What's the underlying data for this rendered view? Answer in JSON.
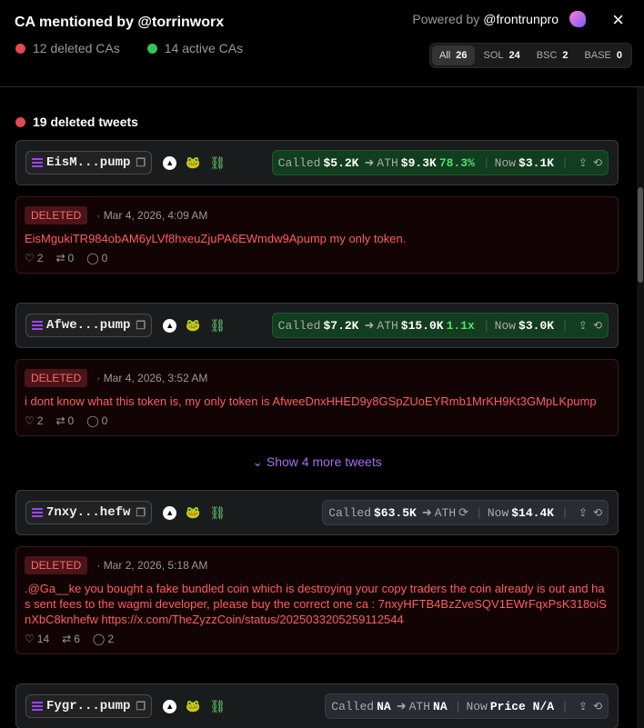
{
  "header": {
    "title": "CA mentioned by @torrinworx",
    "deleted_cas": "12 deleted CAs",
    "active_cas": "14 active CAs",
    "powered_by": "Powered by",
    "powered_handle": "@frontrunpro",
    "close_icon": "×"
  },
  "chain_filter": [
    {
      "label": "All",
      "count": "26",
      "active": true
    },
    {
      "label": "SOL",
      "count": "24"
    },
    {
      "label": "BSC",
      "count": "2"
    },
    {
      "label": "BASE",
      "count": "0"
    }
  ],
  "section": {
    "label": "19 deleted tweets"
  },
  "groups": [
    {
      "ca": "EisM...pump",
      "stats": {
        "called_label": "Called",
        "called": "$5.2K",
        "ath_label": "ATH",
        "ath": "$9.3K",
        "pct": "78.3%",
        "now_label": "Now",
        "now": "$3.1K",
        "style": "green"
      },
      "tweets": [
        {
          "badge": "DELETED",
          "date": "· Mar 4, 2026, 4:09 AM",
          "text": "EisMgukiTR984obAM6yLVf8hxeuZjuPA6EWmdw9Apump my only token.",
          "likes": "2",
          "retweets": "0",
          "replies": "0"
        }
      ]
    },
    {
      "ca": "Afwe...pump",
      "stats": {
        "called_label": "Called",
        "called": "$7.2K",
        "ath_label": "ATH",
        "ath": "$15.0K",
        "pct": "1.1x",
        "now_label": "Now",
        "now": "$3.0K",
        "style": "green"
      },
      "tweets": [
        {
          "badge": "DELETED",
          "date": "· Mar 4, 2026, 3:52 AM",
          "text": "i dont know what this token is, my only token is AfweeDnxHHED9y8GSpZUoEYRmb1MrKH9Kt3GMpLKpump",
          "likes": "2",
          "retweets": "0",
          "replies": "0"
        }
      ],
      "show_more": "Show 4 more tweets"
    },
    {
      "ca": "7nxy...hefw",
      "stats": {
        "called_label": "Called",
        "called": "$63.5K",
        "ath_label": "ATH",
        "ath": "",
        "pct": "",
        "now_label": "Now",
        "now": "$14.4K",
        "style": "gray"
      },
      "tweets": [
        {
          "badge": "DELETED",
          "date": "· Mar 2, 2026, 5:18 AM",
          "text": ".@Ga__ke you bought a fake bundled coin which is destroying your copy traders the coin already is out and has sent fees to the wagmi developer, please buy the correct one ca : 7nxyHFTB4BzZveSQV1EWrFqxPsK318oiSnXbC8knhefw https://x.com/TheZyzzCoin/status/2025033205259112544",
          "likes": "14",
          "retweets": "6",
          "replies": "2"
        }
      ]
    },
    {
      "ca": "Fygr...pump",
      "stats": {
        "called_label": "Called",
        "called": "NA",
        "ath_label": "ATH",
        "ath": "NA",
        "pct": "",
        "now_label": "Now",
        "now": "Price N/A",
        "style": "gray"
      },
      "tweets": []
    }
  ]
}
